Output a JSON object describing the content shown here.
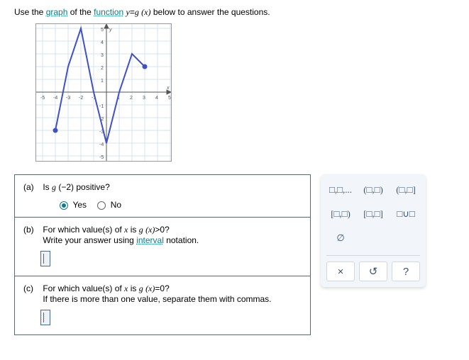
{
  "instruction": {
    "pre": "Use the ",
    "link1": "graph",
    "mid": " of the ",
    "link2": "function",
    "post": " below to answer the questions.",
    "func_lhs": "y",
    "func_eq": "=",
    "func_rhs": "g",
    "func_arg": "(x)"
  },
  "chart_data": {
    "type": "line",
    "title": "",
    "xlabel": "x",
    "ylabel": "y",
    "xlim": [
      -5,
      5
    ],
    "ylim": [
      -5,
      5
    ],
    "x": [
      -4,
      -3,
      -2,
      -1,
      0,
      1,
      2,
      3
    ],
    "y": [
      -3,
      2,
      5,
      0,
      -4,
      0,
      3,
      2
    ],
    "open_endpoints": [],
    "closed_endpoints": [
      [
        -4,
        -3
      ],
      [
        3,
        2
      ]
    ]
  },
  "questions": {
    "a": {
      "label": "(a)",
      "text_pre": "Is ",
      "expr_func": "g",
      "expr_arg": "(−2)",
      "text_post": " positive?",
      "yes": "Yes",
      "no": "No",
      "selected": "yes"
    },
    "b": {
      "label": "(b)",
      "line1_pre": "For which value(s) of ",
      "line1_var": "x",
      "line1_mid": " is ",
      "line1_func": "g",
      "line1_arg": "(x)",
      "line1_op": ">",
      "line1_rhs": "0",
      "line1_end": "?",
      "line2_pre": "Write your answer using ",
      "line2_link": "interval",
      "line2_post": " notation."
    },
    "c": {
      "label": "(c)",
      "line1_pre": "For which value(s) of ",
      "line1_var": "x",
      "line1_mid": " is ",
      "line1_func": "g",
      "line1_arg": "(x)",
      "line1_op": "=",
      "line1_rhs": "0",
      "line1_end": "?",
      "line2": "If there is more than one value, separate them with commas."
    }
  },
  "palette": {
    "items": [
      "□,□,...",
      "(□,□)",
      "(□,□]",
      "[□,□)",
      "[□,□]",
      "□∪□",
      "∅",
      "",
      ""
    ],
    "controls": {
      "clear": "×",
      "reset": "↺",
      "help": "?"
    }
  }
}
